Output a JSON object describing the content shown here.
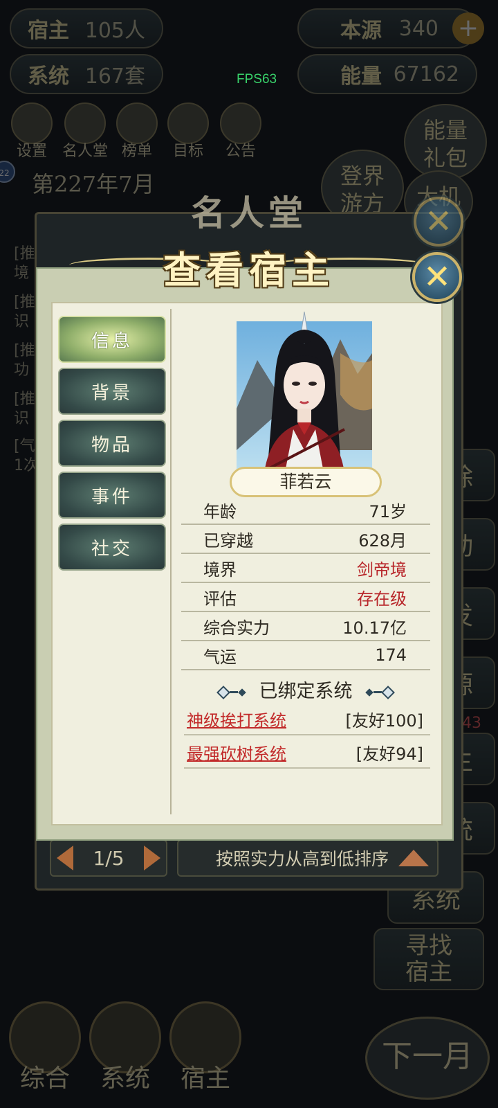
{
  "fps": "FPS63",
  "top_stats": {
    "hosts": {
      "label": "宿主",
      "value": "105人"
    },
    "origin": {
      "label": "本源",
      "value": "340"
    },
    "systems": {
      "label": "系统",
      "value": "167套"
    },
    "energy": {
      "label": "能量",
      "value": "67162"
    }
  },
  "top_icons": [
    "设置",
    "名人堂",
    "榜单",
    "目标",
    "公告"
  ],
  "side_buttons": {
    "energy_gift": "能量\n礼包",
    "travel": "登界\n游方",
    "chance": "大机",
    "right_col": [
      "除",
      "动",
      "发",
      "源",
      "主",
      "统",
      "系统"
    ],
    "find_host": "寻找\n宿主",
    "badge_43": "43"
  },
  "date_label": "第227年7月",
  "badge_22": "22",
  "log_fragments": [
    "[推",
    "境",
    "[推",
    "识",
    "[推",
    "功",
    "[推",
    "识",
    "[气",
    "1次"
  ],
  "bottom_tabs": [
    "综合",
    "系统",
    "宿主"
  ],
  "next_month": "下一月",
  "hall": {
    "title": "名人堂",
    "pager": {
      "page": "1/5"
    },
    "sort_label": "按照实力从高到低排序"
  },
  "dialog": {
    "title": "查看宿主",
    "tabs": [
      {
        "label": "信息",
        "active": true
      },
      {
        "label": "背景",
        "active": false
      },
      {
        "label": "物品",
        "active": false
      },
      {
        "label": "事件",
        "active": false
      },
      {
        "label": "社交",
        "active": false
      }
    ],
    "name": "菲若云",
    "info": [
      {
        "key": "年龄",
        "value": "71岁",
        "red": false
      },
      {
        "key": "已穿越",
        "value": "628月",
        "red": false
      },
      {
        "key": "境界",
        "value": "剑帝境",
        "red": true
      },
      {
        "key": "评估",
        "value": "存在级",
        "red": true
      },
      {
        "key": "综合实力",
        "value": "10.17亿",
        "red": false
      },
      {
        "key": "气运",
        "value": "174",
        "red": false
      }
    ],
    "bound_title": "已绑定系统",
    "systems": [
      {
        "name": "神级挨打系统",
        "friendship": "[友好100]"
      },
      {
        "name": "最强砍树系统",
        "friendship": "[友好94]"
      }
    ]
  },
  "colors": {
    "red_value": "#b8262a",
    "fps_green": "#39d36b",
    "gold": "#d8c277"
  }
}
